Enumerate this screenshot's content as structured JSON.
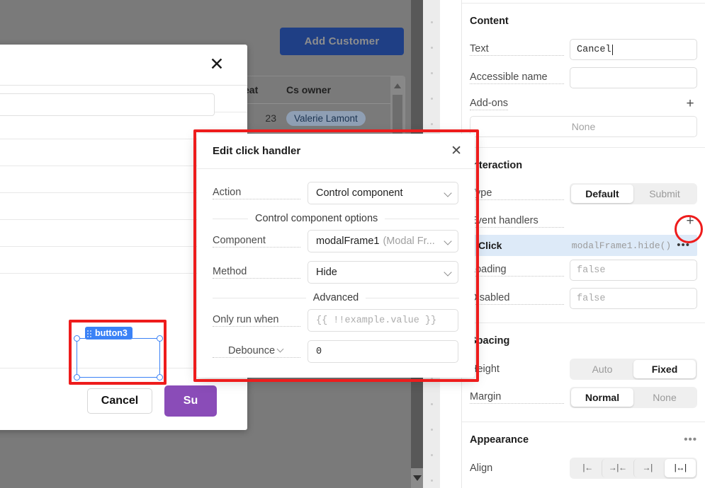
{
  "canvas": {
    "add_customer_button": "Add Customer",
    "table": {
      "columns": [
        "eat",
        "Cs owner"
      ],
      "rows": [
        {
          "seat": "23",
          "owner": "Valerie Lamont"
        }
      ]
    },
    "modal": {
      "close_icon": "close-icon",
      "cancel_button": "Cancel",
      "submit_button": "Su",
      "selection_badge": "button3"
    }
  },
  "popup": {
    "title": "Edit click handler",
    "close_icon": "close-icon",
    "action_label": "Action",
    "action_value": "Control component",
    "options_separator": "Control component options",
    "component_label": "Component",
    "component_value": "modalFrame1",
    "component_value_muted": "(Modal Fr...",
    "method_label": "Method",
    "method_value": "Hide",
    "advanced_separator": "Advanced",
    "only_run_when_label": "Only run when",
    "only_run_when_placeholder": "{{ !!example.value }}",
    "debounce_label": "Debounce",
    "debounce_value": "0"
  },
  "inspector": {
    "content": {
      "title": "Content",
      "text_label": "Text",
      "text_value": "Cancel",
      "accessible_name_label": "Accessible name",
      "accessible_name_value": "",
      "addons_label": "Add-ons",
      "addons_add_icon": "plus-icon",
      "addons_none": "None"
    },
    "interaction": {
      "title": "Interaction",
      "type_label": "Type",
      "type_options": [
        "Default",
        "Submit"
      ],
      "type_selected": "Default",
      "event_handlers_label": "Event handlers",
      "event_handlers_add_icon": "plus-icon",
      "handlers": [
        {
          "event": "Click",
          "expression": "modalFrame1.hide()",
          "menu_icon": "kebab-icon"
        }
      ],
      "loading_label": "Loading",
      "loading_value": "false",
      "disabled_label": "Disabled",
      "disabled_value": "false"
    },
    "spacing": {
      "title": "Spacing",
      "height_label": "Height",
      "height_options": [
        "Auto",
        "Fixed"
      ],
      "height_selected": "Fixed",
      "margin_label": "Margin",
      "margin_options": [
        "Normal",
        "None"
      ],
      "margin_selected": "Normal"
    },
    "appearance": {
      "title": "Appearance",
      "menu_icon": "kebab-icon",
      "align_label": "Align",
      "align_options": [
        "|←",
        "→|←",
        "→|",
        "|↔|"
      ],
      "align_selected": "|↔|"
    }
  },
  "annotations": {
    "accent_color": "#ee1c1c",
    "popup_highlight": "edit-click-handler-popup",
    "button_highlight": "cancel-button-selection",
    "plus_highlight": "event-handlers-add-button"
  }
}
